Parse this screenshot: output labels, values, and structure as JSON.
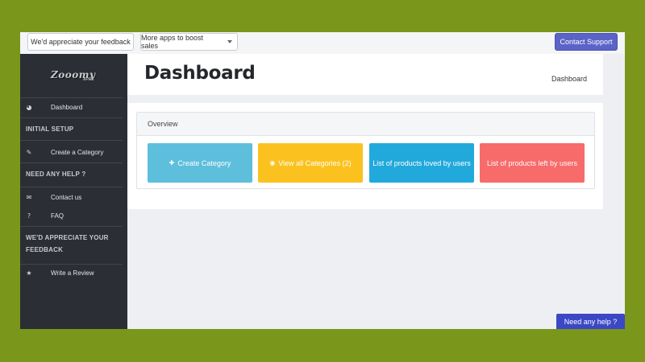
{
  "topbar": {
    "feedback_label": "We'd appreciate your feedback",
    "apps_label": "More apps to boost sales",
    "support_label": "Contact Support"
  },
  "sidebar": {
    "logo_main": "Zooomy",
    "logo_sub": "APPS",
    "dashboard": {
      "label": "Dashboard",
      "icon": "dashboard-icon"
    },
    "section_initial": "INITIAL SETUP",
    "create_category": {
      "label": "Create a Category",
      "icon": "edit-icon"
    },
    "section_help": "NEED ANY HELP ?",
    "contact": {
      "label": "Contact us",
      "icon": "envelope-icon"
    },
    "faq": {
      "label": "FAQ",
      "icon": "question-icon"
    },
    "section_feedback_line1": "WE'D APPRECIATE YOUR",
    "section_feedback_line2": "FEEDBACK",
    "review": {
      "label": "Write a Review",
      "icon": "star-icon"
    }
  },
  "header": {
    "title": "Dashboard",
    "breadcrumb": "Dashboard"
  },
  "overview": {
    "title": "Overview",
    "tiles": [
      {
        "label": "Create Category",
        "icon": "plus-icon",
        "color": "#5dbfdc"
      },
      {
        "label": "View all Categories (2)",
        "icon": "eye-icon",
        "color": "#fbc21f"
      },
      {
        "label": "List of products loved by users",
        "color": "#22a9dc"
      },
      {
        "label": "List of products left by users",
        "color": "#f76b6b"
      }
    ]
  },
  "help_button": "Need any help ?",
  "colors": {
    "background": "#7a961b",
    "sidebar": "#2b2f35",
    "accent": "#5b63c7",
    "help": "#3c47c6"
  }
}
